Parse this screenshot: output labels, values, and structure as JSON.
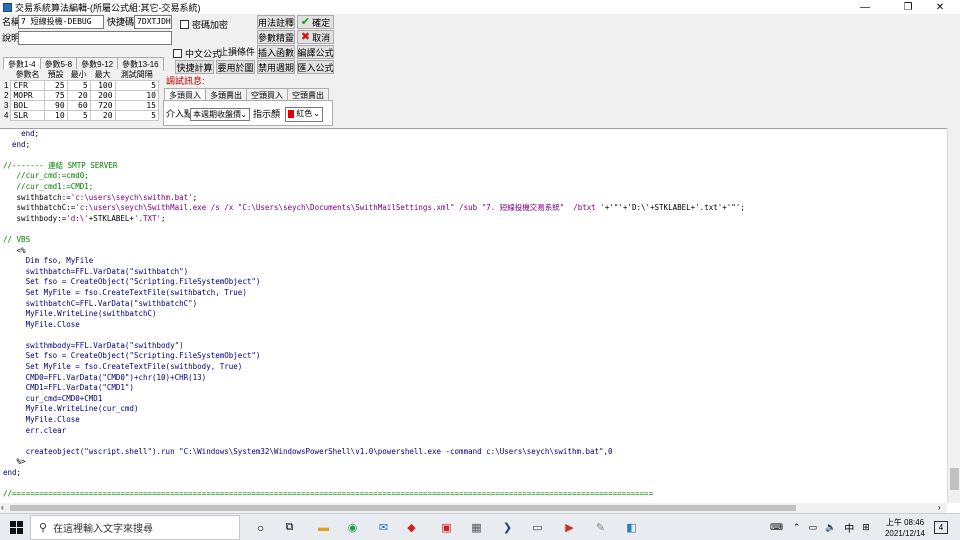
{
  "window": {
    "title": "交易系統算法編輯-(所屬公式組:其它-交易系統)",
    "controls": {
      "minimize": "—",
      "maximize": "❐",
      "close": "✕"
    }
  },
  "form": {
    "name_label": "名稱",
    "name_value": "7 短線投機-DEBUG",
    "hotkey_label": "快捷碼",
    "hotkey_value": "7DXTJDH",
    "password_label": "密碼加密",
    "desc_label": "說明",
    "desc_value": "",
    "chinese_formula_label": "中文公式",
    "stop_condition_label": "止損條件"
  },
  "buttons": {
    "usage": "用法註釋",
    "confirm": "確定",
    "params": "參數精靈",
    "cancel": "取消",
    "insert_func": "插入函數",
    "compile": "編譯公式",
    "quick_calc": "快捷計算",
    "apply_chart": "要用於圖",
    "disable_period": "禁用週期",
    "import": "匯入公式"
  },
  "param_tabs": [
    "參數1-4",
    "參數5-8",
    "參數9-12",
    "參數13-16"
  ],
  "param_table": {
    "headers": [
      "參數名",
      "預設",
      "最小",
      "最大",
      "測試間隔"
    ],
    "rows": [
      {
        "no": "1",
        "name": "CFR",
        "def": "25",
        "min": "5",
        "max": "100",
        "step": "5"
      },
      {
        "no": "2",
        "name": "MOPR",
        "def": "75",
        "min": "20",
        "max": "200",
        "step": "10"
      },
      {
        "no": "3",
        "name": "BOL",
        "def": "90",
        "min": "60",
        "max": "720",
        "step": "15"
      },
      {
        "no": "4",
        "name": "SLR",
        "def": "10",
        "min": "5",
        "max": "20",
        "step": "5"
      }
    ]
  },
  "debug": {
    "label": "調試訊息:",
    "tabs": [
      "多頭買入",
      "多頭賣出",
      "空頭買入",
      "空頭賣出"
    ],
    "entry_label": "介入點",
    "entry_value": "本週期收盤價",
    "indicator_label": "指示顏",
    "indicator_value": "紅色"
  },
  "code_lines": [
    [
      [
        "pl",
        "    "
      ],
      [
        "kw",
        "end"
      ],
      [
        "pl",
        ";"
      ]
    ],
    [
      [
        "pl",
        "  "
      ],
      [
        "kw",
        "end"
      ],
      [
        "pl",
        ";"
      ]
    ],
    [
      [
        "pl",
        ""
      ]
    ],
    [
      [
        "cm",
        "//------- 連結 SMTP SERVER"
      ]
    ],
    [
      [
        "cm",
        "   //cur_cmd:=cmd0;"
      ]
    ],
    [
      [
        "cm",
        "   //cur_cmd1:=CMD1;"
      ]
    ],
    [
      [
        "pl",
        "   swithbatch:="
      ],
      [
        "st",
        "'c:\\users\\seych\\swithm.bat'"
      ],
      [
        "pl",
        ";"
      ]
    ],
    [
      [
        "pl",
        "   swithbatchC:="
      ],
      [
        "st",
        "'c:\\users\\seych\\SwithMail.exe /s /x \"C:\\Users\\seych\\Documents\\SwithMailSettings.xml\" /sub \"7. 短線投機交易系統\"  /btxt '"
      ],
      [
        "pl",
        "+'\"'+'D:\\'+STKLABEL+'.txt'+'\"';"
      ]
    ],
    [
      [
        "pl",
        "   swithbody:="
      ],
      [
        "st",
        "'d:\\'"
      ],
      [
        "pl",
        "+STKLABEL+"
      ],
      [
        "st",
        "'.TXT'"
      ],
      [
        "pl",
        ";"
      ]
    ],
    [
      [
        "pl",
        ""
      ]
    ],
    [
      [
        "cm",
        "// VBS"
      ]
    ],
    [
      [
        "pl",
        "   <%"
      ]
    ],
    [
      [
        "vb",
        "     Dim fso, MyFile"
      ]
    ],
    [
      [
        "vb",
        "     swithbatch=FFL.VarData(\"swithbatch\")"
      ]
    ],
    [
      [
        "vb",
        "     Set fso = CreateObject(\"Scripting.FileSystemObject\")"
      ]
    ],
    [
      [
        "vb",
        "     Set MyFile = fso.CreateTextFile(swithbatch, True)"
      ]
    ],
    [
      [
        "vb",
        "     swithbatchC=FFL.VarData(\"swithbatchC\")"
      ]
    ],
    [
      [
        "vb",
        "     MyFile.WriteLine(swithbatchC)"
      ]
    ],
    [
      [
        "vb",
        "     MyFile.Close"
      ]
    ],
    [
      [
        "pl",
        ""
      ]
    ],
    [
      [
        "vb",
        "     swithmbody=FFL.VarData(\"swithbody\")"
      ]
    ],
    [
      [
        "vb",
        "     Set fso = CreateObject(\"Scripting.FileSystemObject\")"
      ]
    ],
    [
      [
        "vb",
        "     Set MyFile = fso.CreateTextFile(swithbody, True)"
      ]
    ],
    [
      [
        "vb",
        "     CMD0=FFL.VarData(\"CMD0\")+chr(10)+CHR(13)"
      ]
    ],
    [
      [
        "vb",
        "     CMD1=FFL.VarData(\"CMD1\")"
      ]
    ],
    [
      [
        "vb",
        "     cur_cmd=CMD0+CMD1"
      ]
    ],
    [
      [
        "vb",
        "     MyFile.WriteLine(cur_cmd)"
      ]
    ],
    [
      [
        "vb",
        "     MyFile.Close"
      ]
    ],
    [
      [
        "vb",
        "     err.clear"
      ]
    ],
    [
      [
        "pl",
        ""
      ]
    ],
    [
      [
        "vb",
        "     createobject(\"wscript.shell\").run \"C:\\Windows\\System32\\WindowsPowerShell\\v1.0\\powershell.exe -command c:\\Users\\seych\\swithm.bat\",0"
      ]
    ],
    [
      [
        "pl",
        "   %>"
      ]
    ],
    [
      [
        "kw",
        "end"
      ],
      [
        "pl",
        ";"
      ]
    ],
    [
      [
        "pl",
        ""
      ]
    ],
    [
      [
        "cm",
        "//=============================================================================================================================================="
      ]
    ]
  ],
  "taskbar": {
    "search_placeholder": "在這裡輸入文字來搜尋",
    "ime": "中",
    "time": "上午 08:46",
    "date": "2021/12/14",
    "notifications": "4"
  }
}
